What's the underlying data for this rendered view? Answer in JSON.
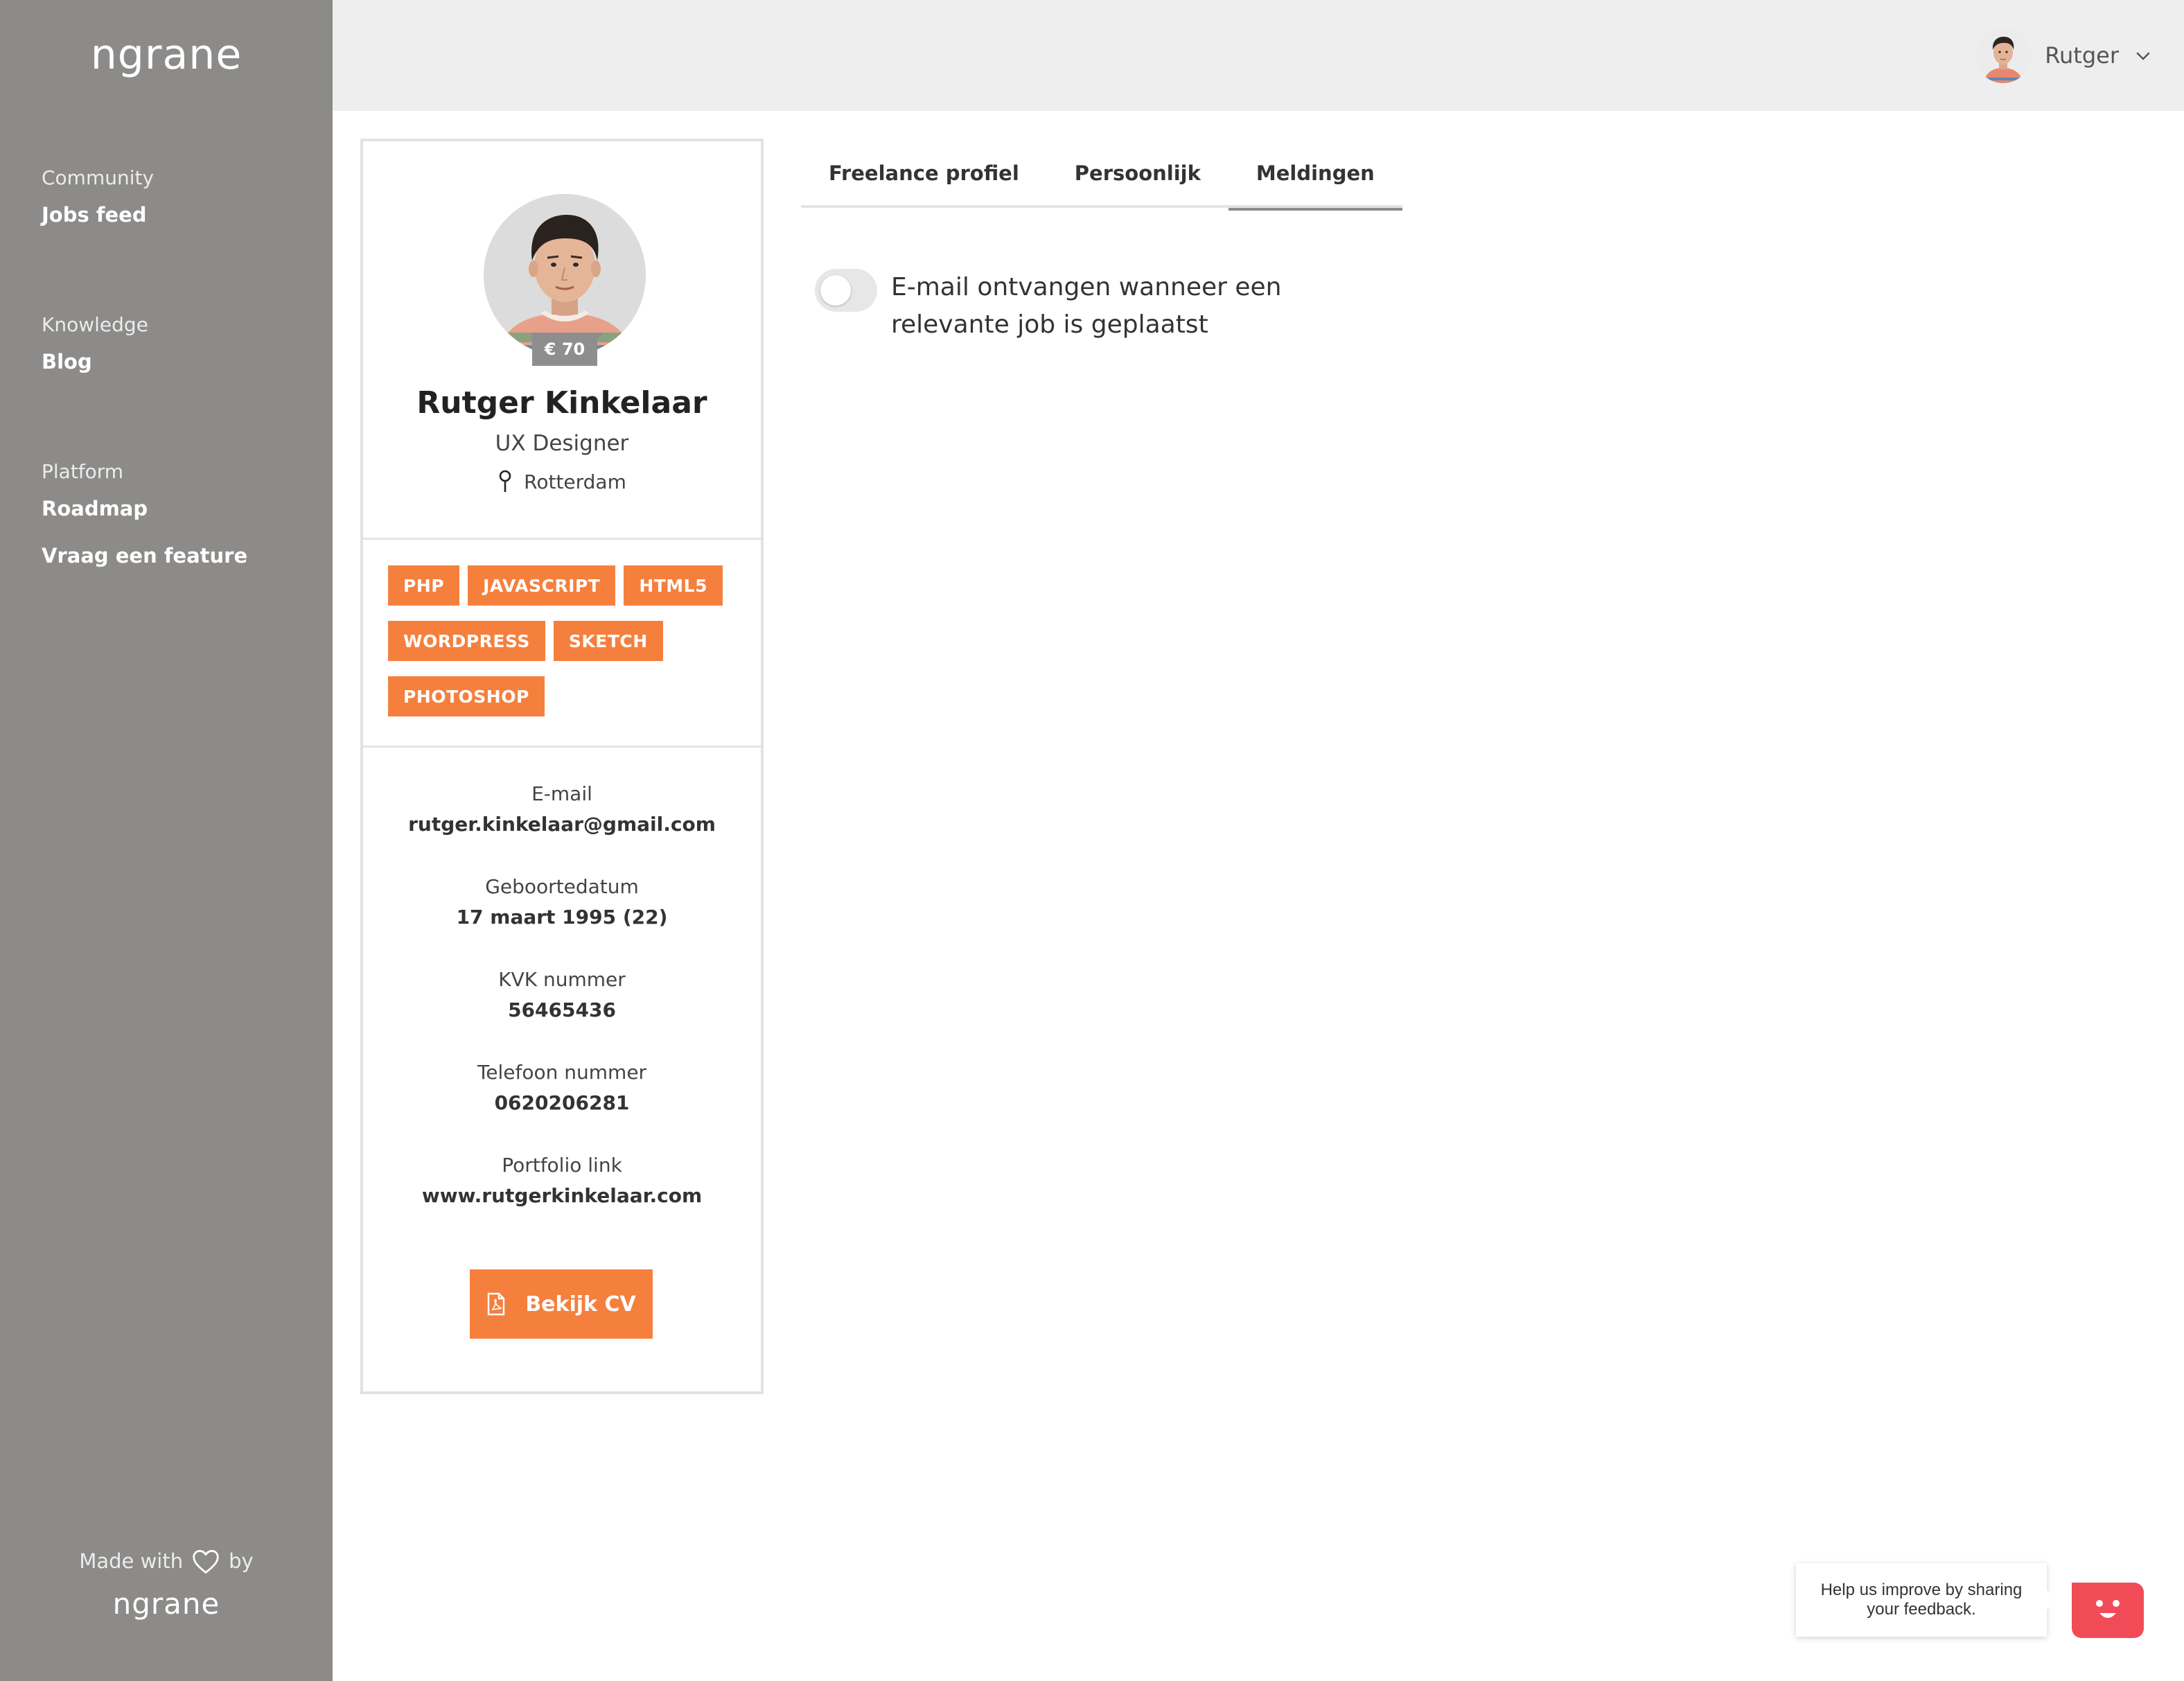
{
  "brand": {
    "name": "ngrane"
  },
  "sidebar": {
    "groups": [
      {
        "heading": "Community",
        "links": [
          "Jobs feed"
        ]
      },
      {
        "heading": "Knowledge",
        "links": [
          "Blog"
        ]
      },
      {
        "heading": "Platform",
        "links": [
          "Roadmap",
          "Vraag een feature"
        ]
      }
    ],
    "footer": {
      "made_with": "Made with",
      "by": "by",
      "icon": "heart-icon"
    }
  },
  "header": {
    "user_name": "Rutger",
    "dropdown_icon": "chevron-down-icon"
  },
  "profile": {
    "rate": "€ 70",
    "name": "Rutger Kinkelaar",
    "role": "UX Designer",
    "location": "Rotterdam",
    "skills": [
      "PHP",
      "JAVASCRIPT",
      "HTML5",
      "WORDPRESS",
      "SKETCH",
      "PHOTOSHOP"
    ],
    "info": [
      {
        "label": "E-mail",
        "value": "rutger.kinkelaar@gmail.com"
      },
      {
        "label": "Geboortedatum",
        "value": "17 maart 1995 (22)"
      },
      {
        "label": "KVK nummer",
        "value": "56465436"
      },
      {
        "label": "Telefoon nummer",
        "value": "0620206281"
      },
      {
        "label": "Portfolio link",
        "value": "www.rutgerkinkelaar.com"
      }
    ],
    "cv_button": "Bekijk CV"
  },
  "tabs": [
    {
      "label": "Freelance profiel",
      "active": false
    },
    {
      "label": "Persoonlijk",
      "active": false
    },
    {
      "label": "Meldingen",
      "active": true
    }
  ],
  "notifications": {
    "email_toggle_label": "E-mail ontvangen wanneer een relevante job is geplaatst",
    "email_toggle_on": false
  },
  "feedback": {
    "bubble_text": "Help us improve by sharing your feedback."
  },
  "colors": {
    "sidebar": "#8c8b89",
    "accent": "#f5803e",
    "feedback": "#f24b58",
    "topbar": "#eeeeee"
  }
}
